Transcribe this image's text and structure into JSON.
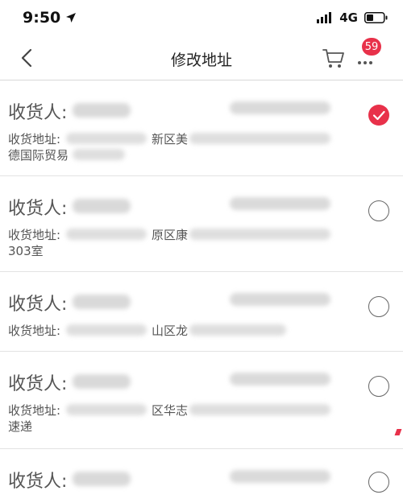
{
  "status_bar": {
    "time": "9:50",
    "network": "4G"
  },
  "nav": {
    "title": "修改地址",
    "cart_badge": "59"
  },
  "addresses": [
    {
      "receiver_label": "收货人:",
      "address_label": "收货地址:",
      "address_fragment": "新区美",
      "second_line": "德国际贸易",
      "selected": true
    },
    {
      "receiver_label": "收货人:",
      "address_label": "收货地址:",
      "address_fragment": "原区康",
      "second_line": "303室",
      "selected": false
    },
    {
      "receiver_label": "收货人:",
      "address_label": "收货地址:",
      "address_fragment": "山区龙",
      "second_line": "",
      "selected": false
    },
    {
      "receiver_label": "收货人:",
      "address_label": "收货地址:",
      "address_fragment": "区华志",
      "second_line": "速递",
      "selected": false
    },
    {
      "receiver_label": "收货人:",
      "address_label": "",
      "address_fragment": "",
      "second_line": "",
      "selected": false
    }
  ],
  "colors": {
    "accent": "#e8314a",
    "divider": "#e3e3e3",
    "text": "#555555"
  }
}
